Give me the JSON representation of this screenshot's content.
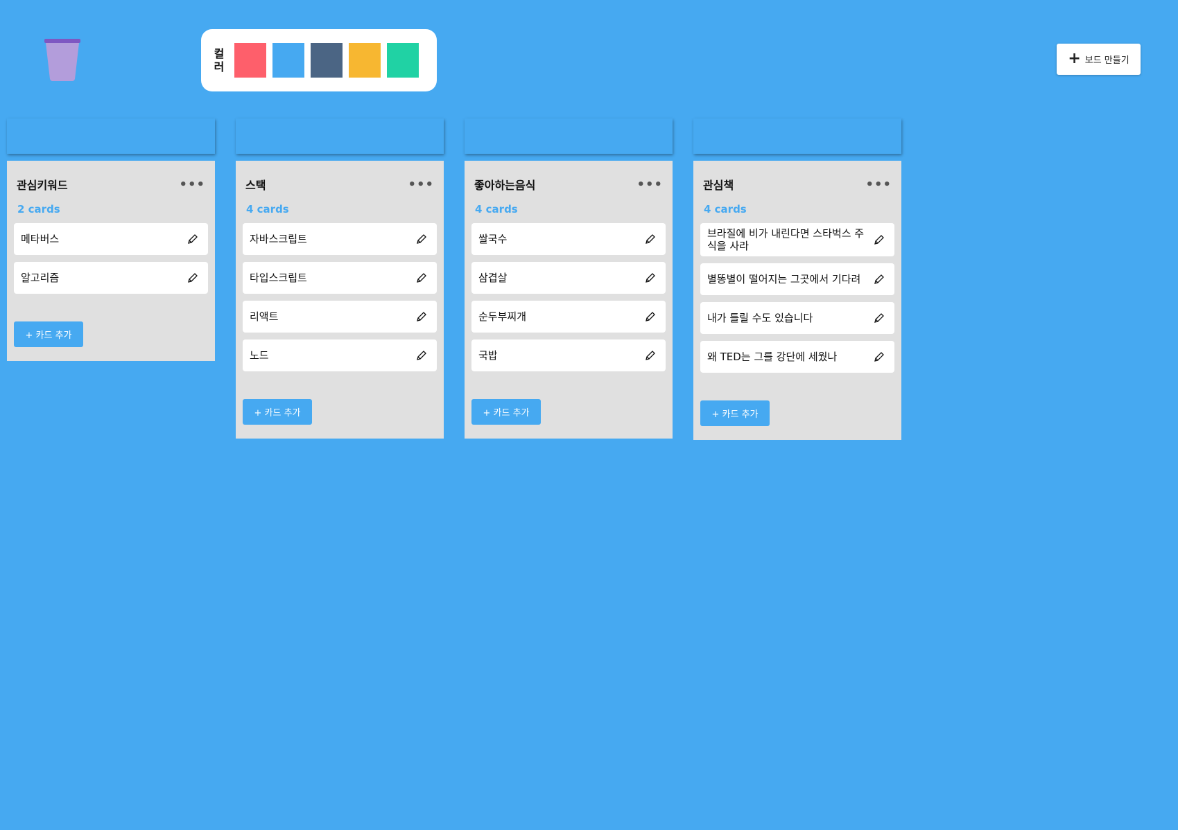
{
  "toolbar": {
    "color_label": "컬러",
    "swatches": [
      "#fe5f6b",
      "#46a9f1",
      "#4b6584",
      "#f7b731",
      "#20d2a4"
    ],
    "create_board_label": "보드 만들기"
  },
  "columns": [
    {
      "title": "관심키워드",
      "count": "2 cards",
      "cards": [
        "메타버스",
        "알고리즘"
      ],
      "add_label": "+ 카드 추가"
    },
    {
      "title": "스택",
      "count": "4 cards",
      "cards": [
        "자바스크립트",
        "타입스크립트",
        "리액트",
        "노드"
      ],
      "add_label": "+ 카드 추가"
    },
    {
      "title": "좋아하는음식",
      "count": "4 cards",
      "cards": [
        "쌀국수",
        "삼겹살",
        "순두부찌개",
        "국밥"
      ],
      "add_label": "+ 카드 추가"
    },
    {
      "title": "관심책",
      "count": "4 cards",
      "cards": [
        "브라질에 비가 내린다면 스타벅스 주식을 사라",
        "별똥별이 떨어지는 그곳에서 기다려",
        "내가 틀릴 수도 있습니다",
        "왜 TED는 그를 강단에 세웠나"
      ],
      "add_label": "+ 카드 추가"
    }
  ],
  "colors": {
    "background": "#46a9f1",
    "column_body": "#e0e0e0",
    "trash": "#b39ddb"
  }
}
